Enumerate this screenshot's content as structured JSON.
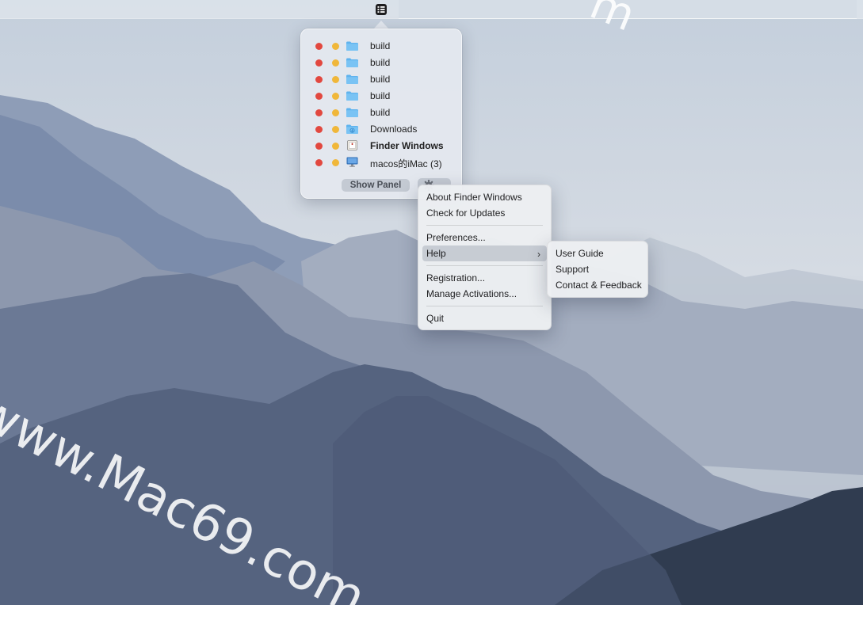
{
  "wallpaper": {
    "description": "misty blue mountain ranges"
  },
  "watermark": {
    "top_text": "m",
    "bottom_text": "www.Mac69.com"
  },
  "menubar": {
    "status_icon": "finder-windows-list-icon"
  },
  "panel": {
    "windows": [
      {
        "label": "build",
        "icon": "folder-icon"
      },
      {
        "label": "build",
        "icon": "folder-icon"
      },
      {
        "label": "build",
        "icon": "folder-icon"
      },
      {
        "label": "build",
        "icon": "folder-icon"
      },
      {
        "label": "build",
        "icon": "folder-icon"
      },
      {
        "label": "Downloads",
        "icon": "downloads-folder-icon"
      },
      {
        "label": "Finder Windows",
        "icon": "app-icon",
        "bold": true
      },
      {
        "label": "macos的iMac (3)",
        "icon": "computer-icon"
      }
    ],
    "show_panel_label": "Show Panel"
  },
  "menu": {
    "about": "About Finder Windows",
    "check_updates": "Check for Updates",
    "preferences": "Preferences...",
    "help": "Help",
    "registration": "Registration...",
    "manage_activations": "Manage Activations...",
    "quit": "Quit"
  },
  "help_menu": {
    "user_guide": "User Guide",
    "support": "Support",
    "contact": "Contact & Feedback"
  },
  "colors": {
    "close_dot": "#e2483f",
    "minimize_dot": "#f0b73a",
    "folder_blue": "#5fb3ee"
  }
}
